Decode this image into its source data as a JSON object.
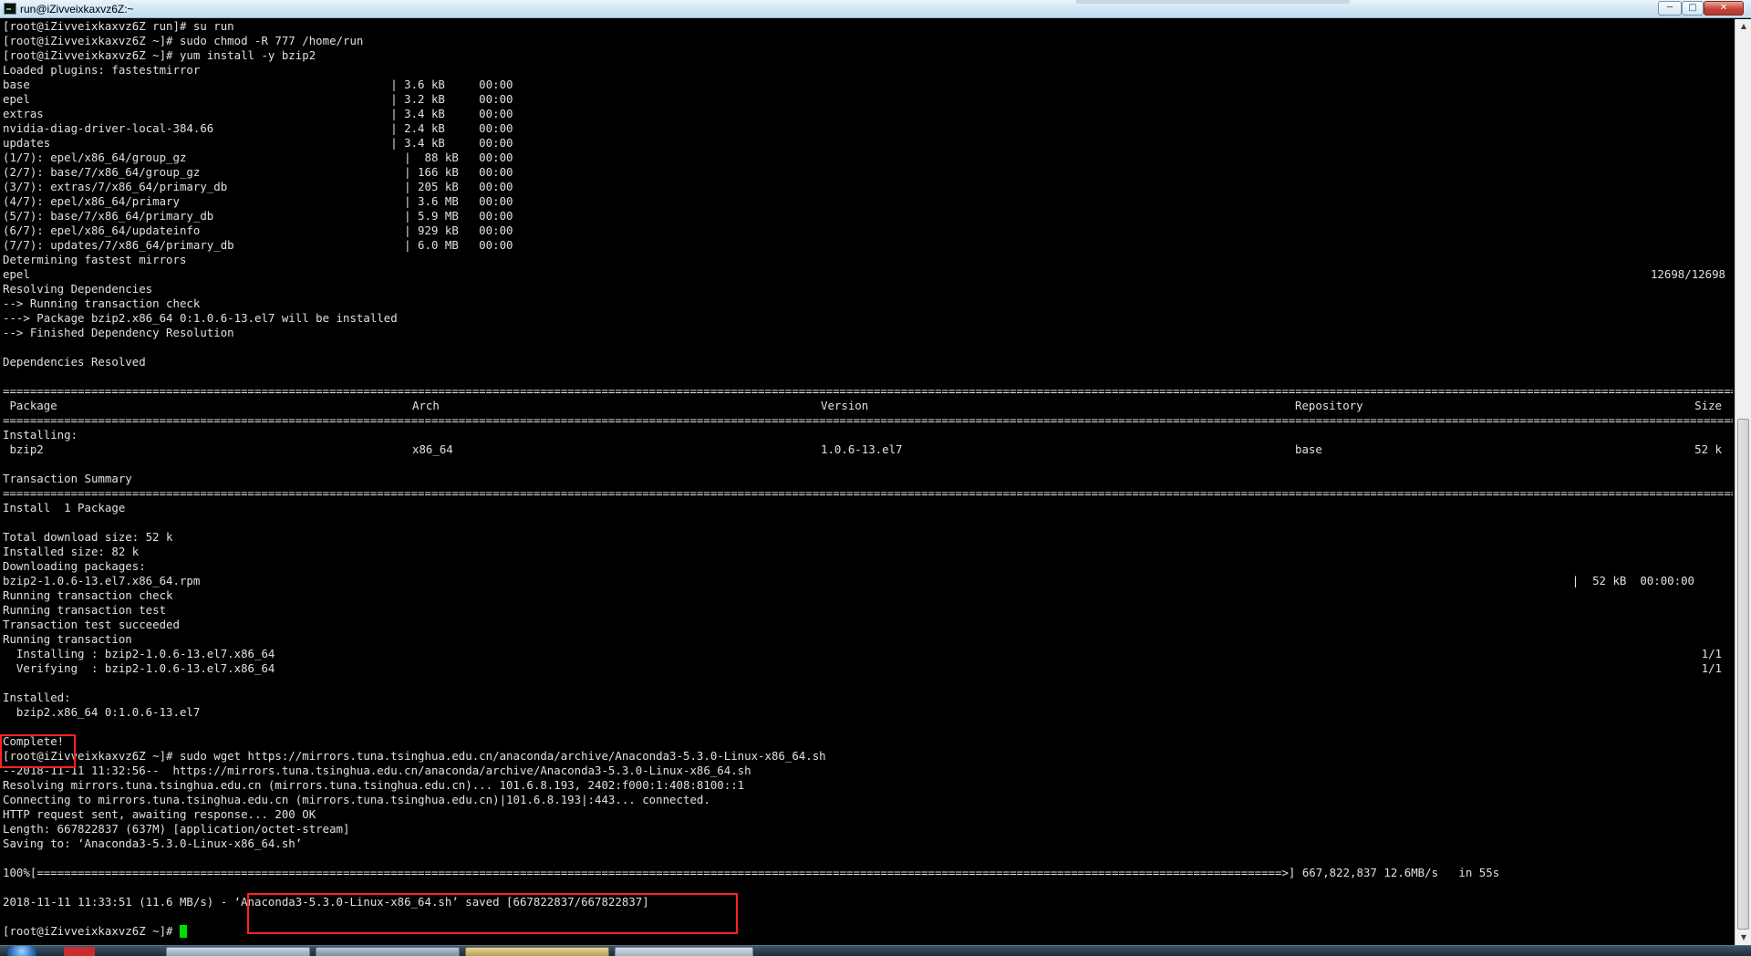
{
  "window": {
    "title": "run@iZivveixkaxvz6Z:~",
    "minimize_glyph": "─",
    "maximize_glyph": "□",
    "close_glyph": "✕"
  },
  "terminal": {
    "lines": [
      {
        "text": "[root@iZivveixkaxvz6Z run]# su run"
      },
      {
        "text": "[root@iZivveixkaxvz6Z ~]# sudo chmod -R 777 /home/run"
      },
      {
        "text": "[root@iZivveixkaxvz6Z ~]# yum install -y bzip2"
      },
      {
        "text": "Loaded plugins: fastestmirror"
      },
      {
        "text": "base                                                     | 3.6 kB     00:00"
      },
      {
        "text": "epel                                                     | 3.2 kB     00:00"
      },
      {
        "text": "extras                                                   | 3.4 kB     00:00"
      },
      {
        "text": "nvidia-diag-driver-local-384.66                          | 2.4 kB     00:00"
      },
      {
        "text": "updates                                                  | 3.4 kB     00:00"
      },
      {
        "text": "(1/7): epel/x86_64/group_gz                                |  88 kB   00:00"
      },
      {
        "text": "(2/7): base/7/x86_64/group_gz                              | 166 kB   00:00"
      },
      {
        "text": "(3/7): extras/7/x86_64/primary_db                          | 205 kB   00:00"
      },
      {
        "text": "(4/7): epel/x86_64/primary                                 | 3.6 MB   00:00"
      },
      {
        "text": "(5/7): base/7/x86_64/primary_db                            | 5.9 MB   00:00"
      },
      {
        "text": "(6/7): epel/x86_64/updateinfo                              | 929 kB   00:00"
      },
      {
        "text": "(7/7): updates/7/x86_64/primary_db                         | 6.0 MB   00:00"
      },
      {
        "text": "Determining fastest mirrors"
      },
      {
        "text": "epel",
        "right": "12698/12698"
      },
      {
        "text": "Resolving Dependencies"
      },
      {
        "text": "--> Running transaction check"
      },
      {
        "text": "---> Package bzip2.x86_64 0:1.0.6-13.el7 will be installed"
      },
      {
        "text": "--> Finished Dependency Resolution"
      },
      {
        "text": ""
      },
      {
        "text": "Dependencies Resolved"
      },
      {
        "text": ""
      },
      {
        "rule": true
      },
      {
        "cols": [
          " Package",
          "Arch",
          "Version",
          "Repository",
          "Size"
        ]
      },
      {
        "rule": true
      },
      {
        "text": "Installing:"
      },
      {
        "cols": [
          " bzip2",
          "x86_64",
          "1.0.6-13.el7",
          "base",
          "52 k"
        ]
      },
      {
        "text": ""
      },
      {
        "text": "Transaction Summary"
      },
      {
        "rule": true
      },
      {
        "text": "Install  1 Package"
      },
      {
        "text": ""
      },
      {
        "text": "Total download size: 52 k"
      },
      {
        "text": "Installed size: 82 k"
      },
      {
        "text": "Downloading packages:"
      },
      {
        "text": "bzip2-1.0.6-13.el7.x86_64.rpm",
        "right": "|  52 kB  00:00:00"
      },
      {
        "text": "Running transaction check"
      },
      {
        "text": "Running transaction test"
      },
      {
        "text": "Transaction test succeeded"
      },
      {
        "text": "Running transaction"
      },
      {
        "text": "  Installing : bzip2-1.0.6-13.el7.x86_64",
        "right": "1/1"
      },
      {
        "text": "  Verifying  : bzip2-1.0.6-13.el7.x86_64",
        "right": "1/1"
      },
      {
        "text": ""
      },
      {
        "text": "Installed:"
      },
      {
        "text": "  bzip2.x86_64 0:1.0.6-13.el7"
      },
      {
        "text": ""
      },
      {
        "text": "Complete!"
      },
      {
        "text": "[root@iZivveixkaxvz6Z ~]# sudo wget https://mirrors.tuna.tsinghua.edu.cn/anaconda/archive/Anaconda3-5.3.0-Linux-x86_64.sh"
      },
      {
        "text": "--2018-11-11 11:32:56--  https://mirrors.tuna.tsinghua.edu.cn/anaconda/archive/Anaconda3-5.3.0-Linux-x86_64.sh"
      },
      {
        "text": "Resolving mirrors.tuna.tsinghua.edu.cn (mirrors.tuna.tsinghua.edu.cn)... 101.6.8.193, 2402:f000:1:408:8100::1"
      },
      {
        "text": "Connecting to mirrors.tuna.tsinghua.edu.cn (mirrors.tuna.tsinghua.edu.cn)|101.6.8.193|:443... connected."
      },
      {
        "text": "HTTP request sent, awaiting response... 200 OK"
      },
      {
        "text": "Length: 667822837 (637M) [application/octet-stream]"
      },
      {
        "text": "Saving to: ‘Anaconda3-5.3.0-Linux-x86_64.sh’"
      },
      {
        "text": ""
      },
      {
        "progress": true,
        "prefix": "100%[",
        "suffix": "=>] 667,822,837 12.6MB/s   in 55s"
      },
      {
        "text": ""
      },
      {
        "text": "2018-11-11 11:33:51 (11.6 MB/s) - ‘Anaconda3-5.3.0-Linux-x86_64.sh’ saved [667822837/667822837]"
      },
      {
        "text": ""
      },
      {
        "text": "[root@iZivveixkaxvz6Z ~]# ",
        "cursor": true
      }
    ],
    "rule_char": "=",
    "progress_char": "=",
    "progress_fraction": 1.0,
    "colors": {
      "fg": "#e0e0e0",
      "bg": "#000000",
      "cursor": "#00e000",
      "highlight": "#ff2222"
    }
  },
  "icons": [
    "app-terminal-icon",
    "start-orb-icon",
    "scroll-up-arrow-icon",
    "scroll-down-arrow-icon"
  ],
  "scrollbar": {
    "up_glyph": "▲",
    "down_glyph": "▼"
  }
}
